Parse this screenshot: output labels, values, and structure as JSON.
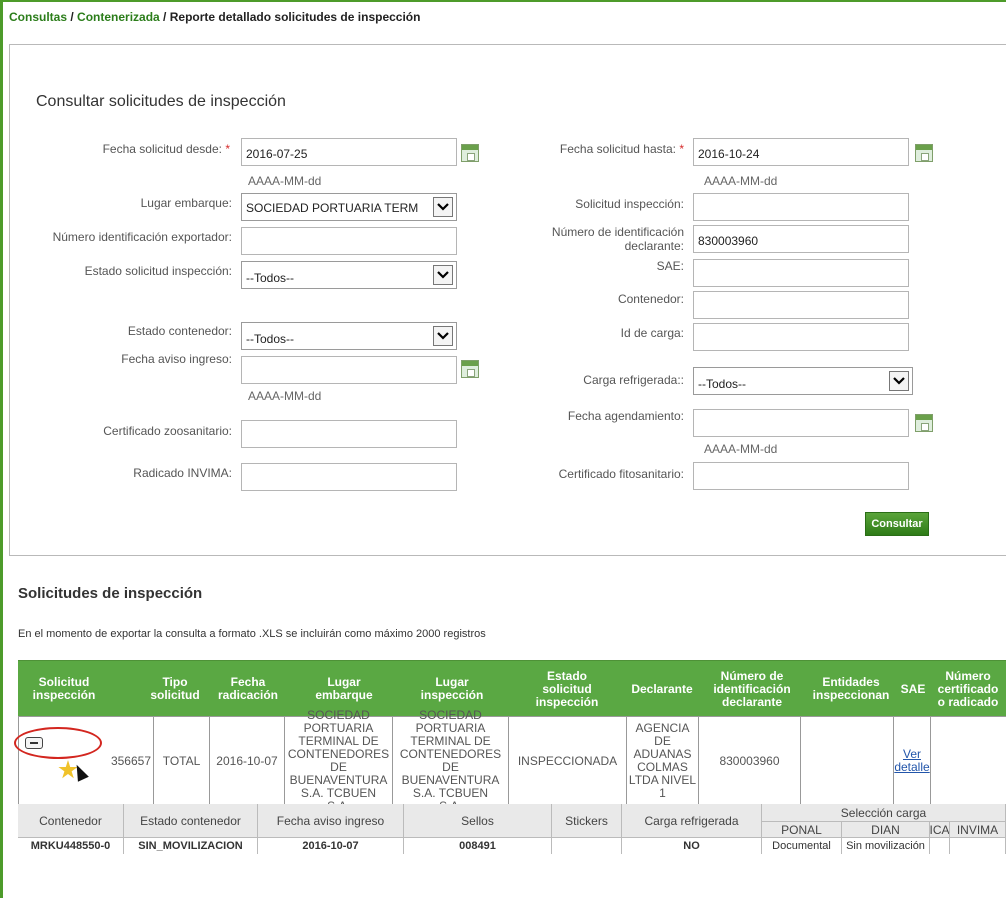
{
  "breadcrumb": {
    "item1": "Consultas",
    "separator": " / ",
    "item2": "Contenerizada",
    "current": "Reporte detallado solicitudes de inspección"
  },
  "form": {
    "title": "Consultar solicitudes de inspección",
    "required_mark": "*",
    "date_hint": "AAAA-MM-dd",
    "fecha_desde": {
      "label": "Fecha solicitud desde:",
      "value": "2016-07-25"
    },
    "fecha_hasta": {
      "label": "Fecha solicitud hasta:",
      "value": "2016-10-24"
    },
    "lugar_embarque": {
      "label": "Lugar embarque:",
      "value": "SOCIEDAD PORTUARIA TERM"
    },
    "solicitud_inspeccion": {
      "label": "Solicitud inspección:",
      "value": ""
    },
    "num_id_exportador": {
      "label": "Número identificación exportador:",
      "value": ""
    },
    "num_id_declarante": {
      "label": "Número de identificación\ndeclarante:",
      "value": "830003960"
    },
    "estado_solicitud": {
      "label": "Estado solicitud inspección:",
      "value": "--Todos--"
    },
    "sae": {
      "label": "SAE:",
      "value": ""
    },
    "contenedor": {
      "label": "Contenedor:",
      "value": ""
    },
    "estado_contenedor": {
      "label": "Estado contenedor:",
      "value": "--Todos--"
    },
    "id_carga": {
      "label": "Id de carga:",
      "value": ""
    },
    "fecha_aviso_ingreso": {
      "label": "Fecha aviso ingreso:",
      "value": ""
    },
    "carga_refrigerada": {
      "label": "Carga refrigerada::",
      "value": "--Todos--"
    },
    "fecha_agendamiento": {
      "label": "Fecha agendamiento:",
      "value": ""
    },
    "certificado_zoosanitario": {
      "label": "Certificado zoosanitario:",
      "value": ""
    },
    "radicado_invima": {
      "label": "Radicado INVIMA:",
      "value": ""
    },
    "certificado_fitosanitario": {
      "label": "Certificado fitosanitario:",
      "value": ""
    },
    "submit_label": "Consultar"
  },
  "results": {
    "title": "Solicitudes de inspección",
    "export_note": "En el momento de exportar la consulta a formato .XLS se incluirán como máximo 2000 registros",
    "headers": [
      "Solicitud\ninspección",
      "Tipo\nsolicitud",
      "Fecha\nradicación",
      "Lugar\nembarque",
      "Lugar\ninspección",
      "Estado\nsolicitud\ninspección",
      "Declarante",
      "Número de\nidentificación\ndeclarante",
      "Entidades\ninspeccionan",
      "SAE",
      "Número\ncertificado\no radicado"
    ],
    "row": {
      "solicitud": "356657",
      "tipo": "TOTAL",
      "fecha": "2016-10-07",
      "lugar_embarque": "SOCIEDAD\nPORTUARIA\nTERMINAL DE\nCONTENEDORES\nDE\nBUENAVENTURA\nS.A. TCBUEN\nS.A.",
      "lugar_inspeccion": "SOCIEDAD\nPORTUARIA\nTERMINAL DE\nCONTENEDORES\nDE\nBUENAVENTURA\nS.A. TCBUEN\nS.A.",
      "estado": "INSPECCIONADA",
      "declarante": "AGENCIA\nDE\nADUANAS\nCOLMAS\nLTDA NIVEL\n1",
      "num_id": "830003960",
      "entidades": "",
      "sae_link": "Ver\ndetalle",
      "num_certificado": ""
    },
    "detail": {
      "headers": {
        "contenedor": "Contenedor",
        "estado_contenedor": "Estado contenedor",
        "fecha_aviso": "Fecha aviso ingreso",
        "sellos": "Sellos",
        "stickers": "Stickers",
        "carga_refrigerada": "Carga refrigerada",
        "seleccion_carga": "Selección carga",
        "ponal": "PONAL",
        "dian": "DIAN",
        "ica": "ICA",
        "invima": "INVIMA"
      },
      "row": {
        "contenedor": "MRKU448550-0",
        "estado_contenedor": "SIN_MOVILIZACION",
        "fecha_aviso": "2016-10-07",
        "sellos": "008491",
        "stickers": "",
        "carga_refrigerada": "NO",
        "ponal": "Documental",
        "dian": "Sin movilización",
        "ica": "",
        "invima": ""
      }
    }
  }
}
